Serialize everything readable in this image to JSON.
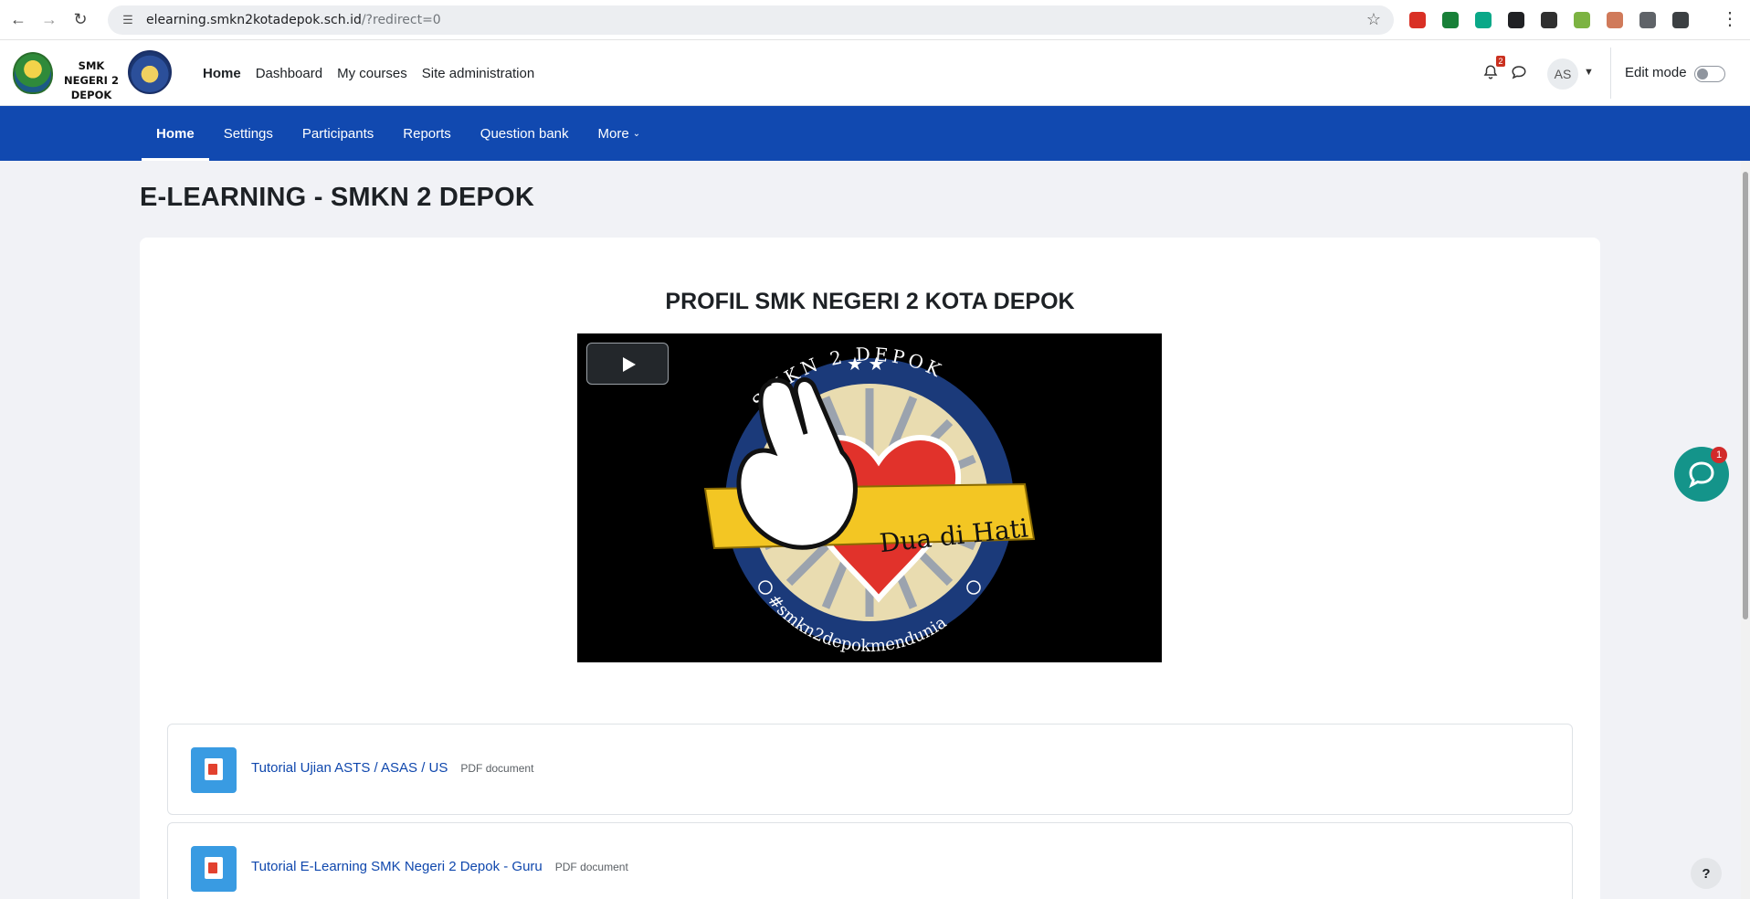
{
  "browser": {
    "url_host": "elearning.smkn2kotadepok.sch.id",
    "url_path": "/?redirect=0",
    "extensions": [
      {
        "name": "vm-extension-icon",
        "color": "#d93025"
      },
      {
        "name": "sheets-extension-icon",
        "color": "#188038"
      },
      {
        "name": "refresh-extension-icon",
        "color": "#0aa888"
      },
      {
        "name": "spy-extension-icon",
        "color": "#202124"
      },
      {
        "name": "sync-extension-icon",
        "color": "#303030"
      },
      {
        "name": "palette-extension-icon",
        "color": "#7cb342"
      },
      {
        "name": "screen-extension-icon",
        "color": "#d07a5a"
      },
      {
        "name": "puzzle-extension-icon",
        "color": "#5f6368"
      },
      {
        "name": "profile-extension-icon",
        "color": "#3c4043"
      }
    ]
  },
  "header": {
    "school_name": "SMK NEGERI 2 DEPOK",
    "nav": [
      {
        "label": "Home",
        "active": true
      },
      {
        "label": "Dashboard",
        "active": false
      },
      {
        "label": "My courses",
        "active": false
      },
      {
        "label": "Site administration",
        "active": false
      }
    ],
    "notification_count": "2",
    "user_initials": "AS",
    "edit_mode_label": "Edit mode"
  },
  "secondary_nav": {
    "items": [
      {
        "label": "Home",
        "active": true
      },
      {
        "label": "Settings",
        "active": false
      },
      {
        "label": "Participants",
        "active": false
      },
      {
        "label": "Reports",
        "active": false
      },
      {
        "label": "Question bank",
        "active": false
      },
      {
        "label": "More",
        "active": false
      }
    ]
  },
  "page": {
    "title": "E-LEARNING - SMKN 2 DEPOK",
    "profile_title": "PROFIL SMK NEGERI 2 KOTA DEPOK",
    "video": {
      "badge_text": "SMKN 2 DEPOK",
      "ribbon_text": "Dua di Hati",
      "hashtag": "#smkn2depokmendunia"
    },
    "resources": [
      {
        "title": "Tutorial Ujian ASTS / ASAS / US",
        "type": "PDF document"
      },
      {
        "title": "Tutorial E-Learning SMK Negeri 2 Depok - Guru",
        "type": "PDF document"
      }
    ]
  },
  "widgets": {
    "chat_badge": "1",
    "help_label": "?"
  },
  "colors": {
    "primary_nav": "#1149b0",
    "link": "#0f47ad",
    "chat_widget": "#14948a"
  }
}
